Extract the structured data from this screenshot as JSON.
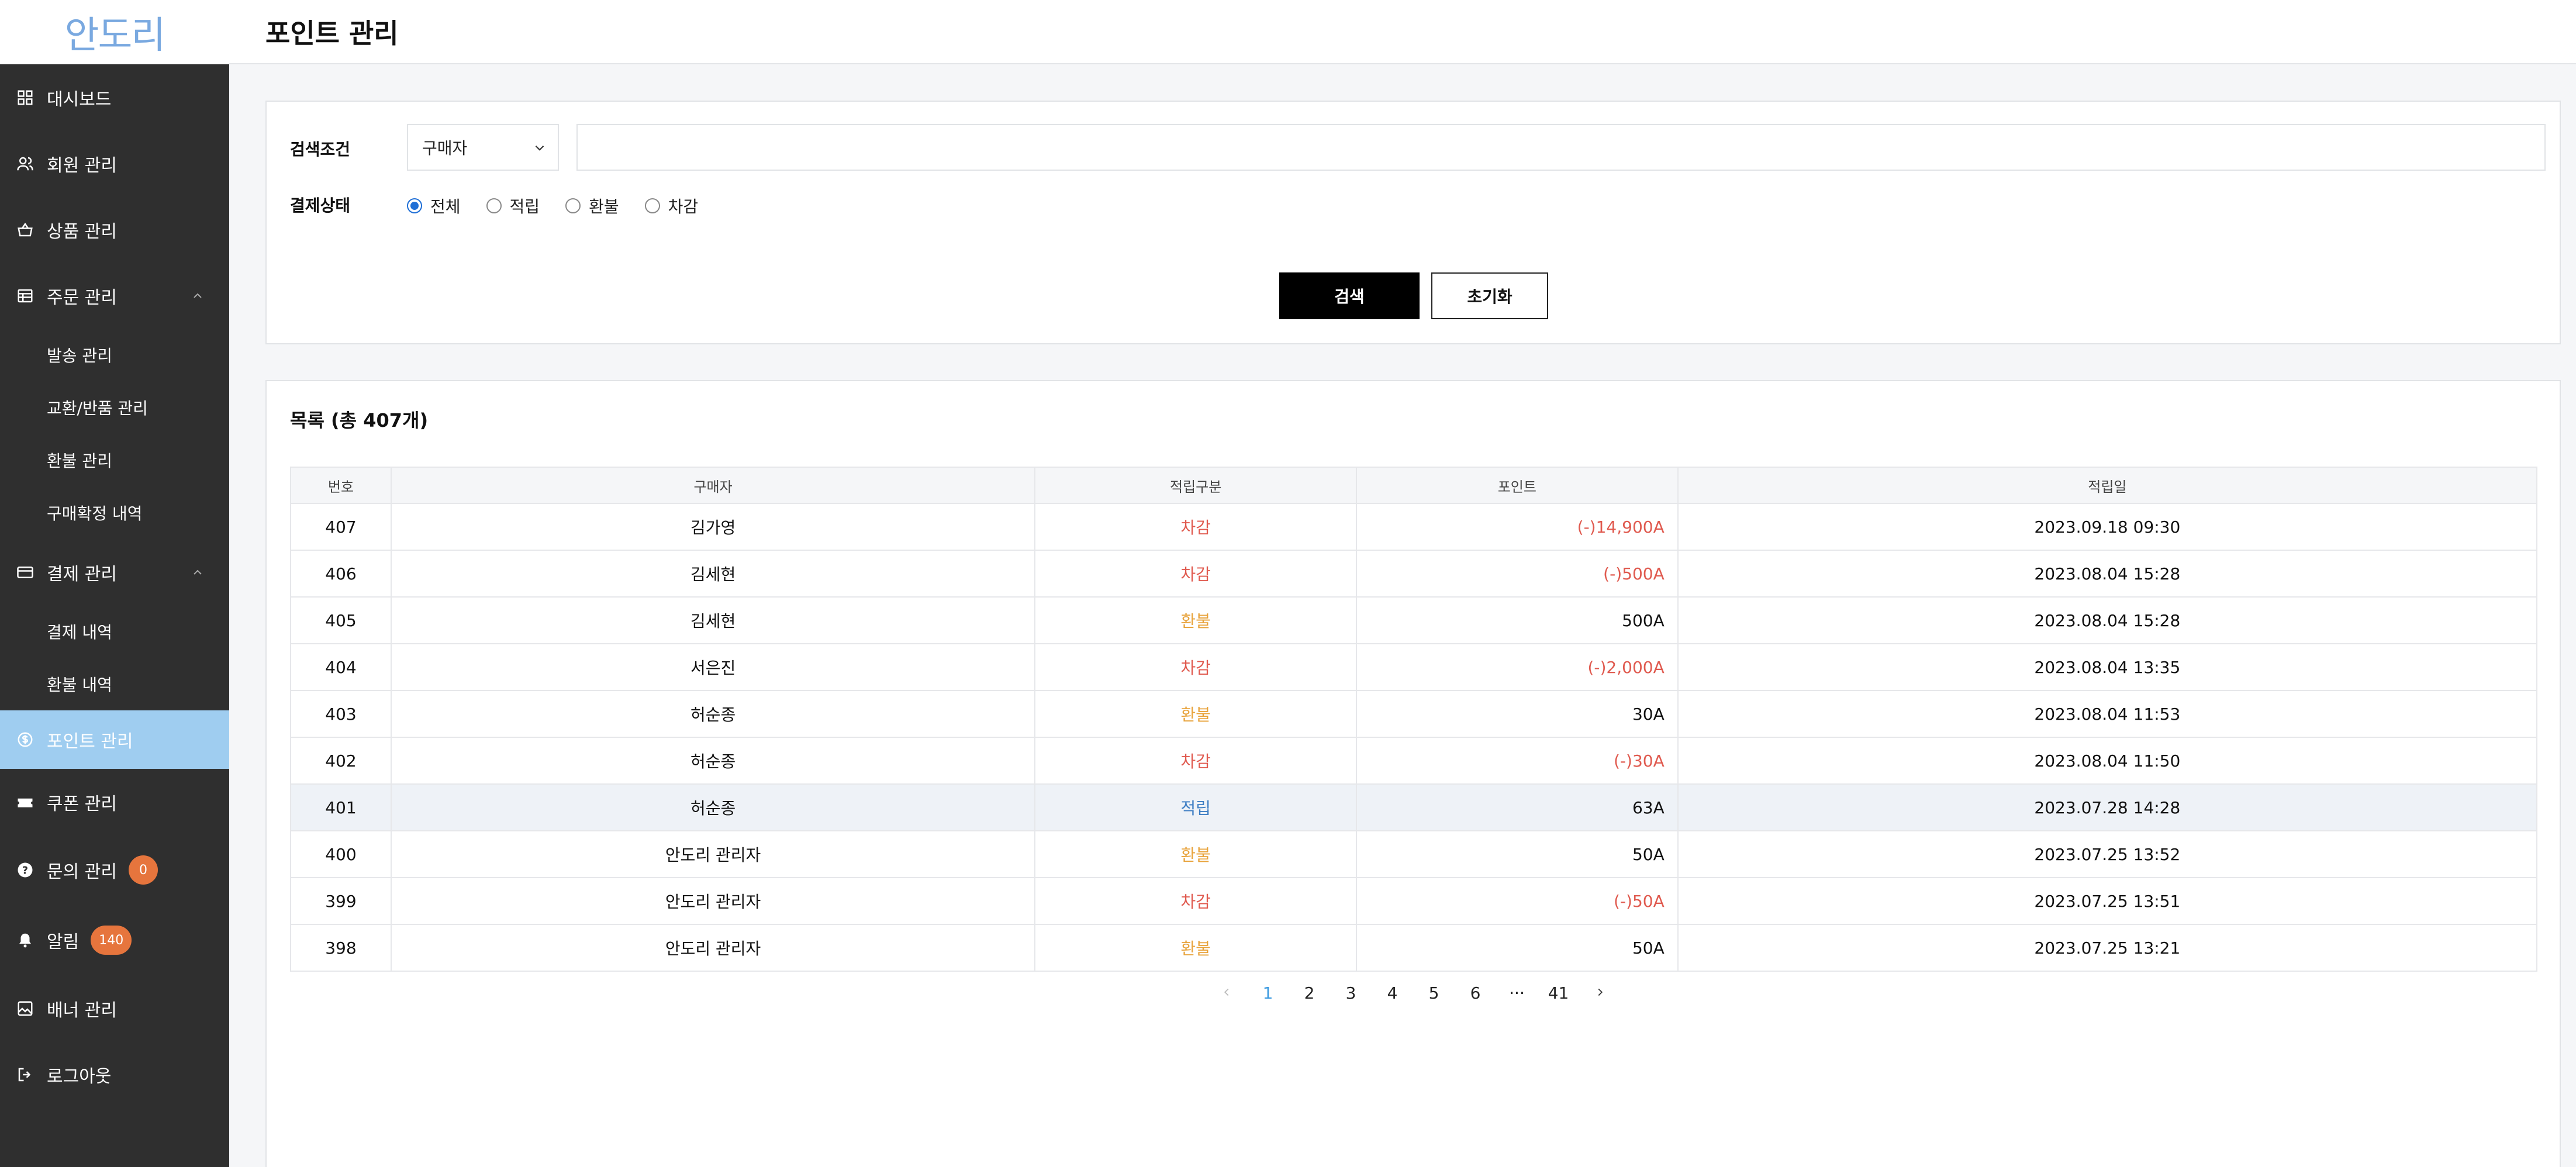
{
  "logo": {
    "text": "안도리"
  },
  "header": {
    "title": "포인트 관리"
  },
  "sidebar": {
    "items": [
      {
        "label": "대시보드",
        "icon": "dashboard-icon"
      },
      {
        "label": "회원 관리",
        "icon": "users-icon"
      },
      {
        "label": "상품 관리",
        "icon": "basket-icon"
      },
      {
        "label": "주문 관리",
        "icon": "table-icon",
        "expanded": true
      },
      {
        "label": "발송 관리"
      },
      {
        "label": "교환/반품 관리"
      },
      {
        "label": "환불 관리"
      },
      {
        "label": "구매확정 내역"
      },
      {
        "label": "결제 관리",
        "icon": "card-icon",
        "expanded": true
      },
      {
        "label": "결제 내역"
      },
      {
        "label": "환불 내역"
      },
      {
        "label": "포인트 관리",
        "icon": "coin-icon",
        "active": true
      },
      {
        "label": "쿠폰 관리",
        "icon": "ticket-icon"
      },
      {
        "label": "문의 관리",
        "icon": "question-icon",
        "badge": "0"
      },
      {
        "label": "알림",
        "icon": "bell-icon",
        "badge": "140"
      },
      {
        "label": "배너 관리",
        "icon": "image-icon"
      },
      {
        "label": "로그아웃",
        "icon": "logout-icon"
      }
    ]
  },
  "search": {
    "condition_label": "검색조건",
    "select_value": "구매자",
    "input_value": "",
    "status_label": "결제상태",
    "radios": [
      "전체",
      "적립",
      "환불",
      "차감"
    ],
    "selected_radio": "전체",
    "search_button": "검색",
    "reset_button": "초기화"
  },
  "list": {
    "title": "목록 (총 407개)",
    "columns": [
      "번호",
      "구매자",
      "적립구분",
      "포인트",
      "적립일"
    ],
    "rows": [
      {
        "no": "407",
        "buyer": "김가영",
        "type": "차감",
        "point": "(-)14,900A",
        "date": "2023.09.18 09:30"
      },
      {
        "no": "406",
        "buyer": "김세현",
        "type": "차감",
        "point": "(-)500A",
        "date": "2023.08.04 15:28"
      },
      {
        "no": "405",
        "buyer": "김세현",
        "type": "환불",
        "point": "500A",
        "date": "2023.08.04 15:28"
      },
      {
        "no": "404",
        "buyer": "서은진",
        "type": "차감",
        "point": "(-)2,000A",
        "date": "2023.08.04 13:35"
      },
      {
        "no": "403",
        "buyer": "허순종",
        "type": "환불",
        "point": "30A",
        "date": "2023.08.04 11:53"
      },
      {
        "no": "402",
        "buyer": "허순종",
        "type": "차감",
        "point": "(-)30A",
        "date": "2023.08.04 11:50"
      },
      {
        "no": "401",
        "buyer": "허순종",
        "type": "적립",
        "point": "63A",
        "date": "2023.07.28 14:28"
      },
      {
        "no": "400",
        "buyer": "안도리 관리자",
        "type": "환불",
        "point": "50A",
        "date": "2023.07.25 13:52"
      },
      {
        "no": "399",
        "buyer": "안도리 관리자",
        "type": "차감",
        "point": "(-)50A",
        "date": "2023.07.25 13:51"
      },
      {
        "no": "398",
        "buyer": "안도리 관리자",
        "type": "환불",
        "point": "50A",
        "date": "2023.07.25 13:21"
      }
    ],
    "highlighted_row": "401"
  },
  "pagination": {
    "pages": [
      "1",
      "2",
      "3",
      "4",
      "5",
      "6",
      "···",
      "41"
    ],
    "current": "1"
  },
  "colors": {
    "deduct": "#e05a4f",
    "refund": "#e8a33b",
    "earn": "#3f7fc4",
    "sidebar_bg": "#2f2f2f",
    "active_bg": "#9fcdf0",
    "badge": "#e6753d"
  }
}
